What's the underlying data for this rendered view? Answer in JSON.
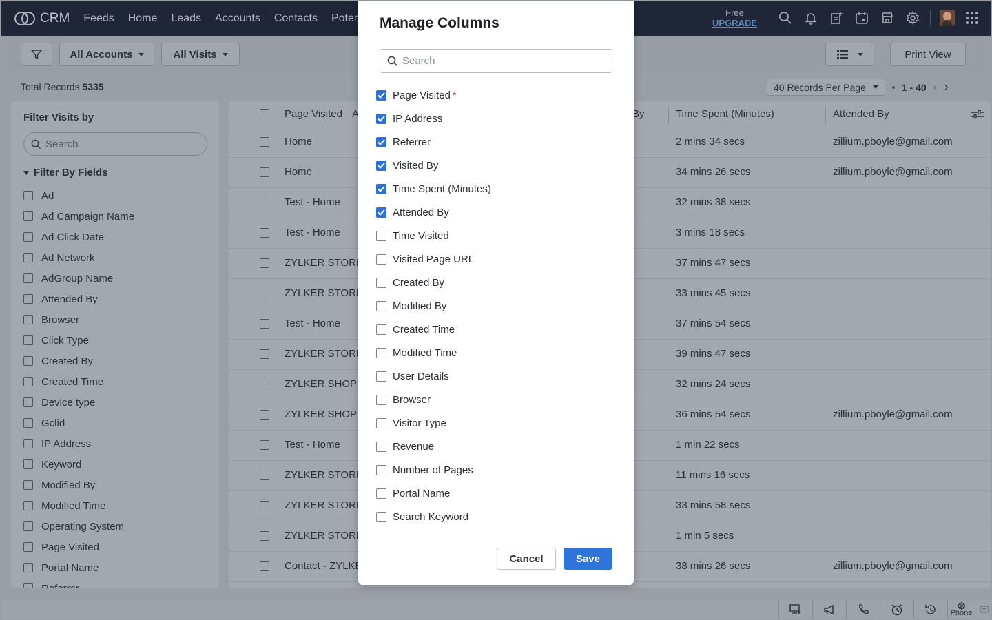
{
  "app": {
    "name": "CRM"
  },
  "nav": {
    "links": [
      "Feeds",
      "Home",
      "Leads",
      "Accounts",
      "Contacts",
      "Potent"
    ],
    "plan_label": "Free",
    "upgrade_label": "UPGRADE",
    "icons": [
      "search-icon",
      "bell-icon",
      "add-note-icon",
      "calendar-icon",
      "marketplace-icon",
      "gear-icon",
      "avatar",
      "apps-grid-icon"
    ]
  },
  "toolbar": {
    "accounts_filter": "All Accounts",
    "visits_filter": "All Visits",
    "print_view": "Print View"
  },
  "records": {
    "label": "Total Records",
    "total": "5335",
    "per_page": "40 Records Per Page",
    "range": "1 - 40"
  },
  "filter_panel": {
    "title": "Filter Visits by",
    "search_placeholder": "Search",
    "group_label": "Filter By Fields",
    "fields": [
      "Ad",
      "Ad Campaign Name",
      "Ad Click Date",
      "Ad Network",
      "AdGroup Name",
      "Attended By",
      "Browser",
      "Click Type",
      "Created By",
      "Created Time",
      "Device type",
      "Gclid",
      "IP Address",
      "Keyword",
      "Modified By",
      "Modified Time",
      "Operating System",
      "Page Visited",
      "Portal Name",
      "Referrer"
    ]
  },
  "table": {
    "headers": {
      "page_visited": "Page Visited",
      "partial": "A",
      "visited_by_partial": "By",
      "time_spent": "Time Spent (Minutes)",
      "attended_by": "Attended By"
    },
    "rows": [
      {
        "page": "Home",
        "time": "2 mins 34 secs",
        "attended": "zillium.pboyle@gmail.com"
      },
      {
        "page": "Home",
        "time": "34 mins 26 secs",
        "attended": "zillium.pboyle@gmail.com"
      },
      {
        "page": "Test - Home",
        "time": "32 mins 38 secs",
        "attended": ""
      },
      {
        "page": "Test - Home",
        "time": "3 mins 18 secs",
        "attended": ""
      },
      {
        "page": "ZYLKER STORE",
        "time": "37 mins 47 secs",
        "attended": ""
      },
      {
        "page": "ZYLKER STORE",
        "time": "33 mins 45 secs",
        "attended": ""
      },
      {
        "page": "Test - Home",
        "time": "37 mins 54 secs",
        "attended": ""
      },
      {
        "page": "ZYLKER STORE",
        "time": "39 mins 47 secs",
        "attended": ""
      },
      {
        "page": "ZYLKER SHOP -",
        "time": "32 mins 24 secs",
        "attended": ""
      },
      {
        "page": "ZYLKER SHOP -",
        "time": "36 mins 54 secs",
        "attended": "zillium.pboyle@gmail.com"
      },
      {
        "page": "Test - Home",
        "time": "1 min 22 secs",
        "attended": ""
      },
      {
        "page": "ZYLKER STORE",
        "time": "11 mins 16 secs",
        "attended": ""
      },
      {
        "page": "ZYLKER STORE",
        "time": "33 mins 58 secs",
        "attended": ""
      },
      {
        "page": "ZYLKER STORE",
        "time": "1 min 5 secs",
        "attended": ""
      },
      {
        "page": "Contact - ZYLKE",
        "time": "38 mins 26 secs",
        "attended": "zillium.pboyle@gmail.com"
      }
    ]
  },
  "modal": {
    "title": "Manage Columns",
    "search_placeholder": "Search",
    "required_mark": "*",
    "columns": [
      {
        "label": "Page Visited",
        "checked": true,
        "required": true
      },
      {
        "label": "IP Address",
        "checked": true
      },
      {
        "label": "Referrer",
        "checked": true
      },
      {
        "label": "Visited By",
        "checked": true
      },
      {
        "label": "Time Spent (Minutes)",
        "checked": true
      },
      {
        "label": "Attended By",
        "checked": true
      },
      {
        "label": "Time Visited",
        "checked": false
      },
      {
        "label": "Visited Page URL",
        "checked": false
      },
      {
        "label": "Created By",
        "checked": false
      },
      {
        "label": "Modified By",
        "checked": false
      },
      {
        "label": "Created Time",
        "checked": false
      },
      {
        "label": "Modified Time",
        "checked": false
      },
      {
        "label": "User Details",
        "checked": false
      },
      {
        "label": "Browser",
        "checked": false
      },
      {
        "label": "Visitor Type",
        "checked": false
      },
      {
        "label": "Revenue",
        "checked": false
      },
      {
        "label": "Number of Pages",
        "checked": false
      },
      {
        "label": "Portal Name",
        "checked": false
      },
      {
        "label": "Search Keyword",
        "checked": false
      }
    ],
    "cancel_label": "Cancel",
    "save_label": "Save",
    "accent": "#2f74d8"
  },
  "statusbar": {
    "phone_label": "Phone",
    "icons": [
      "screen-share-icon",
      "megaphone-icon",
      "call-icon",
      "alarm-icon",
      "history-icon",
      "phone-settings-icon",
      "chat-icon"
    ]
  }
}
